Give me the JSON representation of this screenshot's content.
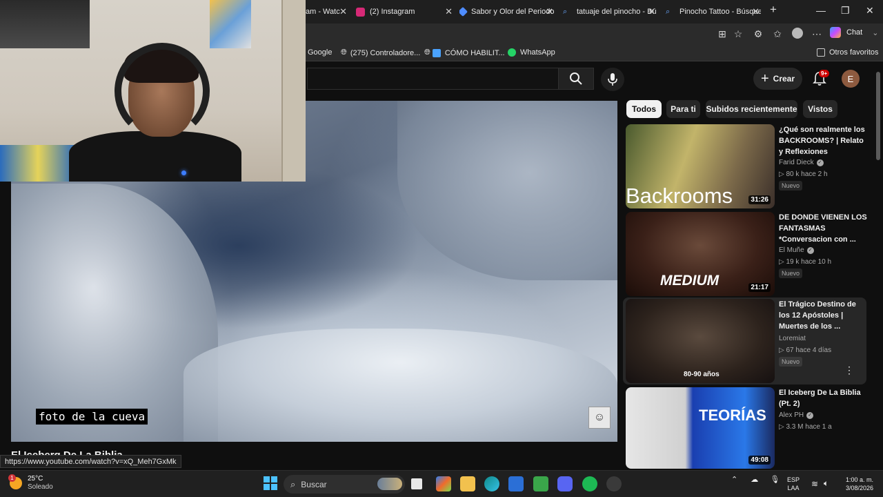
{
  "browser": {
    "tabs": [
      {
        "label": "am - Watc",
        "favicon_color": "#ff0000"
      },
      {
        "label": "(2) Instagram",
        "favicon_color": "#d62976"
      },
      {
        "label": "Sabor y Olor del Periodo",
        "favicon_color": "#4e8cff"
      },
      {
        "label": "tatuaje del pinocho - Bú",
        "favicon_color": "#6aa8ff"
      },
      {
        "label": "Pinocho Tattoo - Búsque",
        "favicon_color": "#6aa8ff"
      }
    ],
    "new_tab_icon": "plus-icon",
    "chat_label": "Chat",
    "bookmarks": [
      {
        "label": "Google",
        "icon": "google-icon"
      },
      {
        "label": "(275) Controladore...",
        "icon": "globe-icon"
      },
      {
        "label": "CÓMO HABILIT...",
        "icon": "globe-icon"
      },
      {
        "label": "WhatsApp",
        "icon": "whatsapp-icon"
      }
    ],
    "other_favorites": "Otros favoritos",
    "status_url": "https://www.youtube.com/watch?v=xQ_Meh7GxMk"
  },
  "youtube": {
    "create_label": "Crear",
    "notifications_badge": "9+",
    "avatar_letter": "E",
    "player": {
      "caption": "foto de la cueva",
      "title": "El Iceberg De La Biblia"
    },
    "chips": [
      "Todos",
      "Para ti",
      "Subidos recientemente",
      "Vistos"
    ],
    "recommendations": [
      {
        "title": "¿Qué son realmente los BACKROOMS? | Relato y Reflexiones",
        "channel": "Farid Dieck",
        "verified": true,
        "views": "80 k",
        "age": "hace 2 h",
        "badge": "Nuevo",
        "duration": "31:26",
        "thumb_text": "Backrooms"
      },
      {
        "title": "DE DONDE VIENEN LOS FANTASMAS *Conversacion con ...",
        "channel": "El Muñe",
        "verified": true,
        "views": "19 k",
        "age": "hace 10 h",
        "badge": "Nuevo",
        "duration": "21:17",
        "thumb_text": "MEDIUM"
      },
      {
        "title": "El Trágico Destino de los 12 Apóstoles | Muertes de los ...",
        "channel": "Loremiat",
        "verified": false,
        "views": "67",
        "age": "hace 4 días",
        "badge": "Nuevo",
        "duration": "",
        "thumb_text": "80-90 años"
      },
      {
        "title": "El Iceberg De La Biblia (Pt. 2)",
        "channel": "Alex PH",
        "verified": true,
        "views": "3.3 M",
        "age": "hace 1 a",
        "badge": "",
        "duration": "49:08",
        "thumb_text": "TEORÍAS"
      }
    ]
  },
  "taskbar": {
    "weather_temp": "25°C",
    "weather_desc": "Soleado",
    "weather_alert": "1",
    "search_placeholder": "Buscar",
    "lang_line1": "ESP",
    "lang_line2": "LAA",
    "time": "1:00 a. m.",
    "date": "3/08/2026"
  }
}
